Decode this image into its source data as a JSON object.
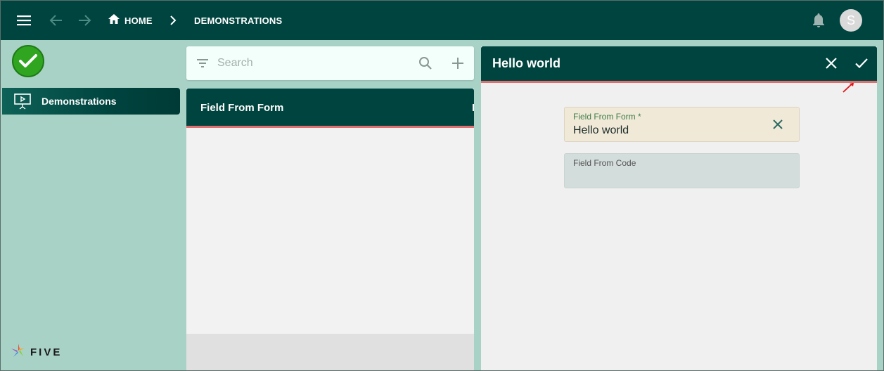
{
  "topbar": {
    "menu_icon": "menu-icon",
    "back_icon": "arrow-back-icon",
    "forward_icon": "arrow-forward-icon",
    "home_label": "HOME",
    "current_label": "DEMONSTRATIONS",
    "avatar_initial": "S",
    "bg_color": "#00443f"
  },
  "sidebar": {
    "items": [
      {
        "label": "Demonstrations",
        "icon": "presentation-icon"
      }
    ],
    "logo_text": "FIVE"
  },
  "search": {
    "placeholder": "Search"
  },
  "list": {
    "header_title": "Field From Form"
  },
  "form": {
    "title": "Hello world",
    "fields": [
      {
        "label": "Field From Form *",
        "value": "Hello world"
      },
      {
        "label": "Field From Code",
        "value": ""
      }
    ]
  },
  "colors": {
    "primary": "#00443f",
    "accent_underline": "#e07070",
    "background": "#a9d2c6",
    "success": "#2fa520"
  }
}
